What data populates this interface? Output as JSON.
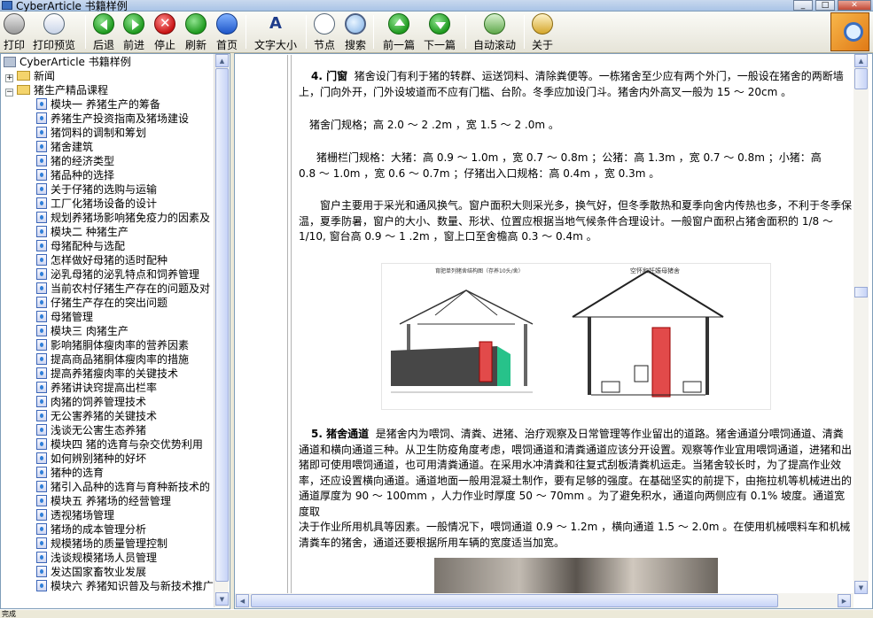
{
  "window": {
    "title": "CyberArticle 书籍样例",
    "buttons": {
      "minimize": "_",
      "maximize": "□",
      "close": "✕"
    }
  },
  "toolbar": {
    "print": "打印",
    "preview": "打印预览",
    "back": "后退",
    "forward": "前进",
    "stop": "停止",
    "refresh": "刷新",
    "home": "首页",
    "font_size": "文字大小",
    "nodes": "节点",
    "search": "搜索",
    "prev_chapter": "前一篇",
    "next_chapter": "下一篇",
    "auto_scroll": "自动滚动",
    "about": "关于"
  },
  "tree": {
    "root": "CyberArticle 书籍样例",
    "expander_collapsed": "+",
    "expander_expanded": "−",
    "folders": [
      "新闻",
      "猪生产精品课程"
    ],
    "items": [
      "模块一 养猪生产的筹备",
      "养猪生产投资指南及猪场建设",
      "猪饲料的调制和筹划",
      "猪舍建筑",
      "猪的经济类型",
      "猪品种的选择",
      "关于仔猪的选购与运输",
      "工厂化猪场设备的设计",
      "规划养猪场影响猪免疫力的因素及",
      "模块二 种猪生产",
      "母猪配种与选配",
      "怎样做好母猪的适时配种",
      "泌乳母猪的泌乳特点和饲养管理",
      "当前农村仔猪生产存在的问题及对",
      "仔猪生产存在的突出问题",
      "母猪管理",
      "模块三 肉猪生产",
      "影响猪胴体瘦肉率的营养因素",
      "提高商品猪胴体瘦肉率的措施",
      "提高养猪瘦肉率的关键技术",
      "养猪讲诀窍提高出栏率",
      "肉猪的饲养管理技术",
      "无公害养猪的关键技术",
      "浅谈无公害生态养猪",
      "模块四 猪的选育与杂交优势利用",
      "如何辨别猪种的好坏",
      "猪种的选育",
      "猪引入品种的选育与育种新技术的",
      "模块五 养猪场的经营管理",
      "透视猪场管理",
      "猪场的成本管理分析",
      "规模猪场的质量管理控制",
      "浅谈规模猪场人员管理",
      "发达国家畜牧业发展",
      "模块六 养猪知识普及与新技术推广"
    ]
  },
  "document": {
    "p1_heading": "4. 门窗",
    "p1_line1": "猪舍设门有利于猪的转群、运送饲料、清除粪便等。一栋猪舍至少应有两个外门，一般设在猪舍的两断墙",
    "p1_line2": "上，门向外开，门外设坡道而不应有门槛、台阶。冬季应加设门斗。猪舍内外高叉一般为 15 ～ 20cm 。",
    "p2": "猪舍门规格；高 2.0 ～ 2 .2m ，宽 1.5 ～ 2 .0m 。",
    "p3_line1": "猪栅栏门规格：大猪：高 0.9 ～ 1.0m ，宽 0.7 ～ 0.8m ；公猪：高 1.3m ，宽 0.7 ～ 0.8m ；小猪：高",
    "p3_line2": "0.8 ～ 1.0m ，宽 0.6 ～ 0.7m ；仔猪出入口规格：高 0.4m ，宽 0.3m 。",
    "p4_line1": "窗户主要用于采光和通风换气。窗户面积大则采光多，换气好，但冬季散热和夏季向舍内传热也多，不利于冬季保",
    "p4_line2": "温，夏季防暑，窗户的大小、数量、形状、位置应根据当地气候条件合理设计。一般窗户面积占猪舍面积的 1/8 ～",
    "p4_line3": "1/10, 窗台高 0.9 ～ 1 .2m ，窗上口至舍檐高 0.3 ～ 0.4m 。",
    "fig_left_title": "育肥单列猪舍结构图（存养10头/舍）",
    "fig_right_title": "空怀和妊娠母猪舍",
    "p5_heading": "5. 猪舍通道",
    "p5_line1": "是猪舍内为喂饲、清粪、进猪、治疗观察及日常管理等作业留出的道路。猪舍通道分喂饲通道、清粪",
    "p5_line2": "通道和横向通道三种。从卫生防疫角度考虑，喂饲通道和清粪通道应该分开设置。观察等作业宜用喂饲通道，进猪和出",
    "p5_line3": "猪即可使用喂饲通道，也可用清粪通道。在采用水冲清粪和往复式刮板清粪机运走。当猪舍较长时，为了提高作业效",
    "p5_line4": "率，还应设置横向通道。通道地面一般用混凝土制作，要有足够的强度。在基础坚实的前提下，由拖拉机等机械进出的",
    "p5_line5": "通道厚度为 90 ～ 100mm ，人力作业时厚度 50 ～ 70mm 。为了避免积水，通道向两侧应有 0.1% 坡度。通道宽度取",
    "p5_line6": "决于作业所用机具等因素。一般情况下，喂饲通道 0.9 ～ 1.2m ，横向通道 1.5 ～ 2.0m 。在使用机械喂料车和机械",
    "p5_line7": "清粪车的猪舍，通道还要根据所用车辆的宽度适当加宽。"
  },
  "status": {
    "text": "完成"
  }
}
